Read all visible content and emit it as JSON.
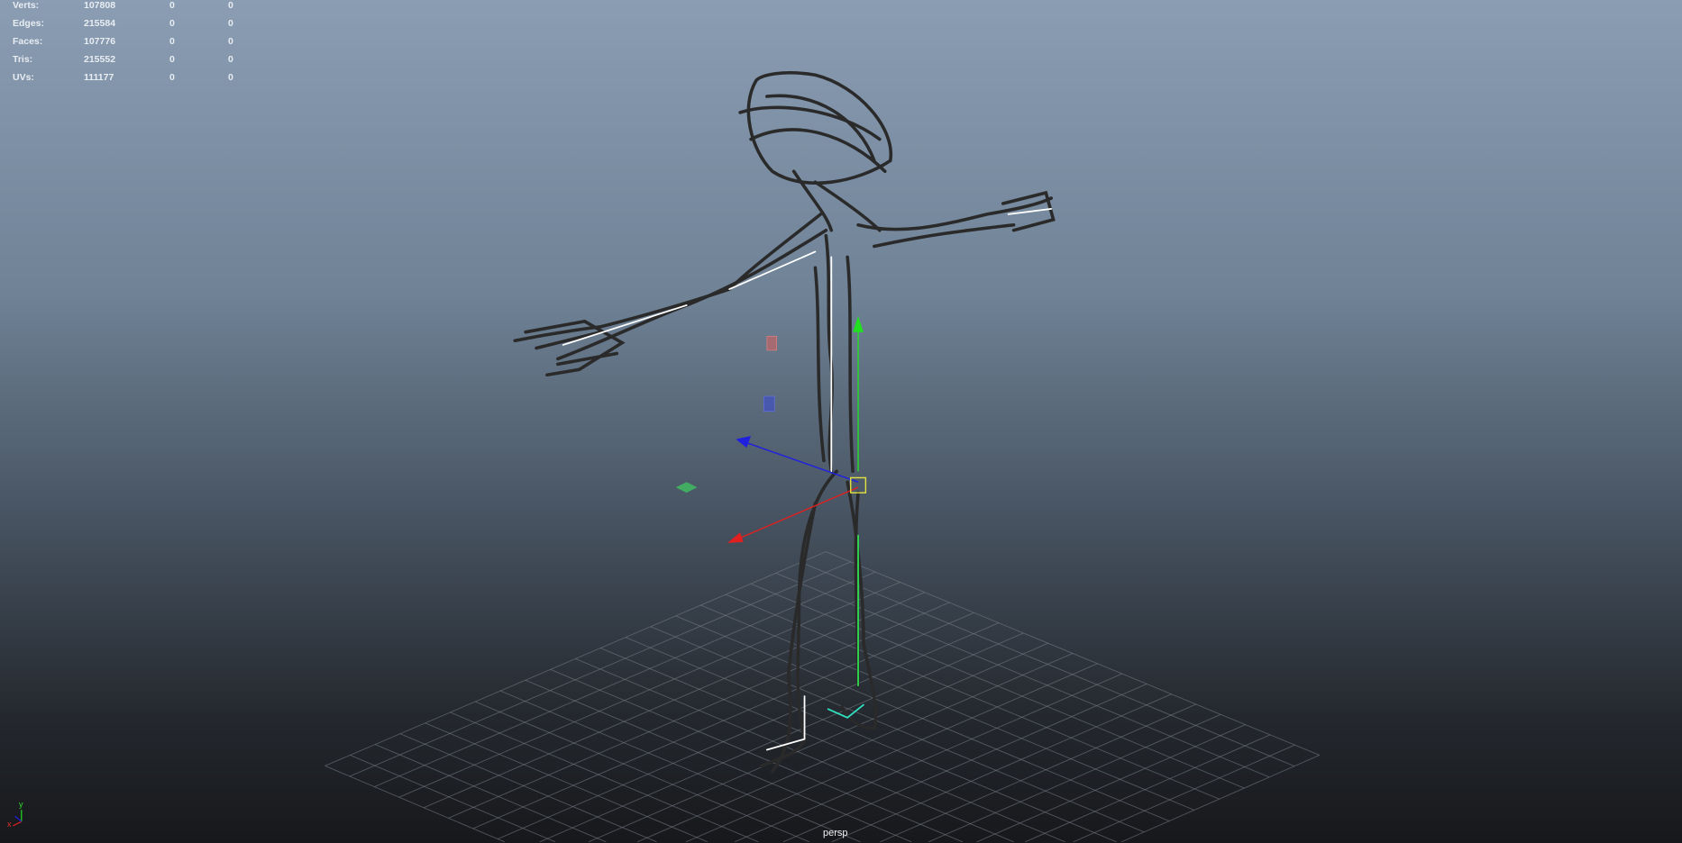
{
  "hud": {
    "rows": [
      {
        "label": "Verts:",
        "value": "107808",
        "sel": "0",
        "comp": "0"
      },
      {
        "label": "Edges:",
        "value": "215584",
        "sel": "0",
        "comp": "0"
      },
      {
        "label": "Faces:",
        "value": "107776",
        "sel": "0",
        "comp": "0"
      },
      {
        "label": "Tris:",
        "value": "215552",
        "sel": "0",
        "comp": "0"
      },
      {
        "label": "UVs:",
        "value": "111177",
        "sel": "0",
        "comp": "0"
      }
    ]
  },
  "camera_label": "persp",
  "axis_indicator": {
    "y_label": "y",
    "x_label": "x"
  },
  "colors": {
    "x_axis": "#e01010",
    "y_axis": "#10e010",
    "z_axis": "#1010e0",
    "pivot": "#e0e040"
  }
}
